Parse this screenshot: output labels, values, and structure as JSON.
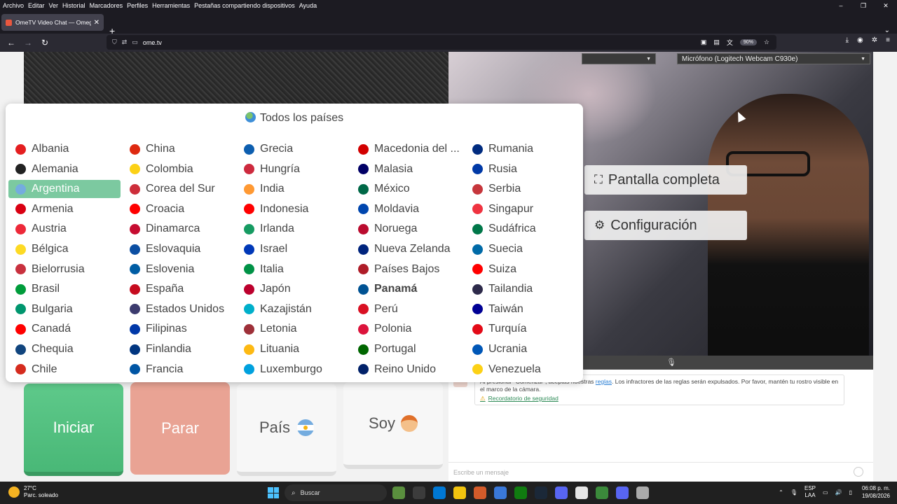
{
  "menubar": [
    "Archivo",
    "Editar",
    "Ver",
    "Historial",
    "Marcadores",
    "Perfiles",
    "Herramientas",
    "Pestañas compartiendo dispositivos",
    "Ayuda"
  ],
  "window_controls": [
    "–",
    "❐",
    "✕"
  ],
  "tab": {
    "title": "OmeTV Video Chat — Omegle",
    "close": "✕",
    "new": "+"
  },
  "nav": {
    "back": "←",
    "forward": "→",
    "reload": "↻"
  },
  "url": "ome.tv",
  "zoom": "90%",
  "popup": {
    "title": "Todos los países",
    "countries": [
      [
        "Albania",
        "Alemania",
        "Argentina",
        "Armenia",
        "Austria",
        "Bélgica",
        "Bielorrusia",
        "Brasil",
        "Bulgaria",
        "Canadá",
        "Chequia",
        "Chile"
      ],
      [
        "China",
        "Colombia",
        "Corea del Sur",
        "Croacia",
        "Dinamarca",
        "Eslovaquia",
        "Eslovenia",
        "España",
        "Estados Unidos",
        "Filipinas",
        "Finlandia",
        "Francia"
      ],
      [
        "Grecia",
        "Hungría",
        "India",
        "Indonesia",
        "Irlanda",
        "Israel",
        "Italia",
        "Japón",
        "Kazajistán",
        "Letonia",
        "Lituania",
        "Luxemburgo"
      ],
      [
        "Macedonia del ...",
        "Malasia",
        "México",
        "Moldavia",
        "Noruega",
        "Nueva Zelanda",
        "Países Bajos",
        "Panamá",
        "Perú",
        "Polonia",
        "Portugal",
        "Reino Unido"
      ],
      [
        "Rumania",
        "Rusia",
        "Serbia",
        "Singapur",
        "Sudáfrica",
        "Suecia",
        "Suiza",
        "Tailandia",
        "Taiwán",
        "Turquía",
        "Ucrania",
        "Venezuela"
      ]
    ],
    "selected": "Argentina",
    "bold": "Panamá"
  },
  "video": {
    "fullscreen": "Pantalla completa",
    "settings": "Configuración",
    "microphone": "Micrófono (Logitech Webcam C930e)"
  },
  "buttons": {
    "start": "Iniciar",
    "stop": "Parar",
    "country": "País",
    "me": "Soy"
  },
  "chat": {
    "notice_pre": "Al presionar \"Comenzar\", aceptas nuestras",
    "rules_link": "reglas",
    "notice_post": ". Los infractores de las reglas serán expulsados. Por favor, mantén tu rostro visible en el marco de la cámara.",
    "safety": "Recordatorio de seguridad",
    "placeholder": "Escribe un mensaje"
  },
  "taskbar": {
    "temp": "27°C",
    "weather": "Parc. soleado",
    "search": "Buscar",
    "lang1": "ESP",
    "lang2": "LAA",
    "time": "06:08 p. m.",
    "date": "19/08/2026"
  },
  "flag_colors": {
    "Albania": "#e41e20",
    "Alemania": "#222222",
    "Argentina": "#74acdf",
    "Armenia": "#d90012",
    "Austria": "#ed2939",
    "Bélgica": "#fdda24",
    "Bielorrusia": "#c8313e",
    "Brasil": "#009c3b",
    "Bulgaria": "#00966e",
    "Canadá": "#ff0000",
    "Chequia": "#11457e",
    "Chile": "#d52b1e",
    "China": "#de2910",
    "Colombia": "#fcd116",
    "Corea del Sur": "#cd2e3a",
    "Croacia": "#ff0000",
    "Dinamarca": "#c60c30",
    "Eslovaquia": "#0b4ea2",
    "Eslovenia": "#005da4",
    "España": "#c60b1e",
    "Estados Unidos": "#3c3b6e",
    "Filipinas": "#0038a8",
    "Finlandia": "#003580",
    "Francia": "#0055a4",
    "Grecia": "#0d5eaf",
    "Hungría": "#cd2a3e",
    "India": "#ff9933",
    "Indonesia": "#ff0000",
    "Irlanda": "#169b62",
    "Israel": "#0038b8",
    "Italia": "#009246",
    "Japón": "#bc002d",
    "Kazajistán": "#00afca",
    "Letonia": "#9e3039",
    "Lituania": "#fdb913",
    "Luxemburgo": "#00a1de",
    "Macedonia del ...": "#d20000",
    "Malasia": "#010066",
    "México": "#006847",
    "Moldavia": "#0046ae",
    "Noruega": "#ba0c2f",
    "Nueva Zelanda": "#00247d",
    "Países Bajos": "#ae1c28",
    "Panamá": "#005293",
    "Perú": "#d91023",
    "Polonia": "#dc143c",
    "Portugal": "#006600",
    "Reino Unido": "#012169",
    "Rumania": "#002b7f",
    "Rusia": "#0039a6",
    "Serbia": "#c6363c",
    "Singapur": "#ef3340",
    "Sudáfrica": "#007749",
    "Suecia": "#006aa7",
    "Suiza": "#ff0000",
    "Tailandia": "#2d2a4a",
    "Taiwán": "#000095",
    "Turquía": "#e30a17",
    "Ucrania": "#0057b7",
    "Venezuela": "#fcd116"
  },
  "taskbar_icon_colors": [
    "#5a8f3e",
    "#3c3c3c",
    "#0078d4",
    "#f2c40f",
    "#d45b2a",
    "#3a78d8",
    "#107c10",
    "#1b2838",
    "#5865f2",
    "#e6e6e6",
    "#3b8a3b",
    "#5865f2",
    "#aaaaaa"
  ]
}
